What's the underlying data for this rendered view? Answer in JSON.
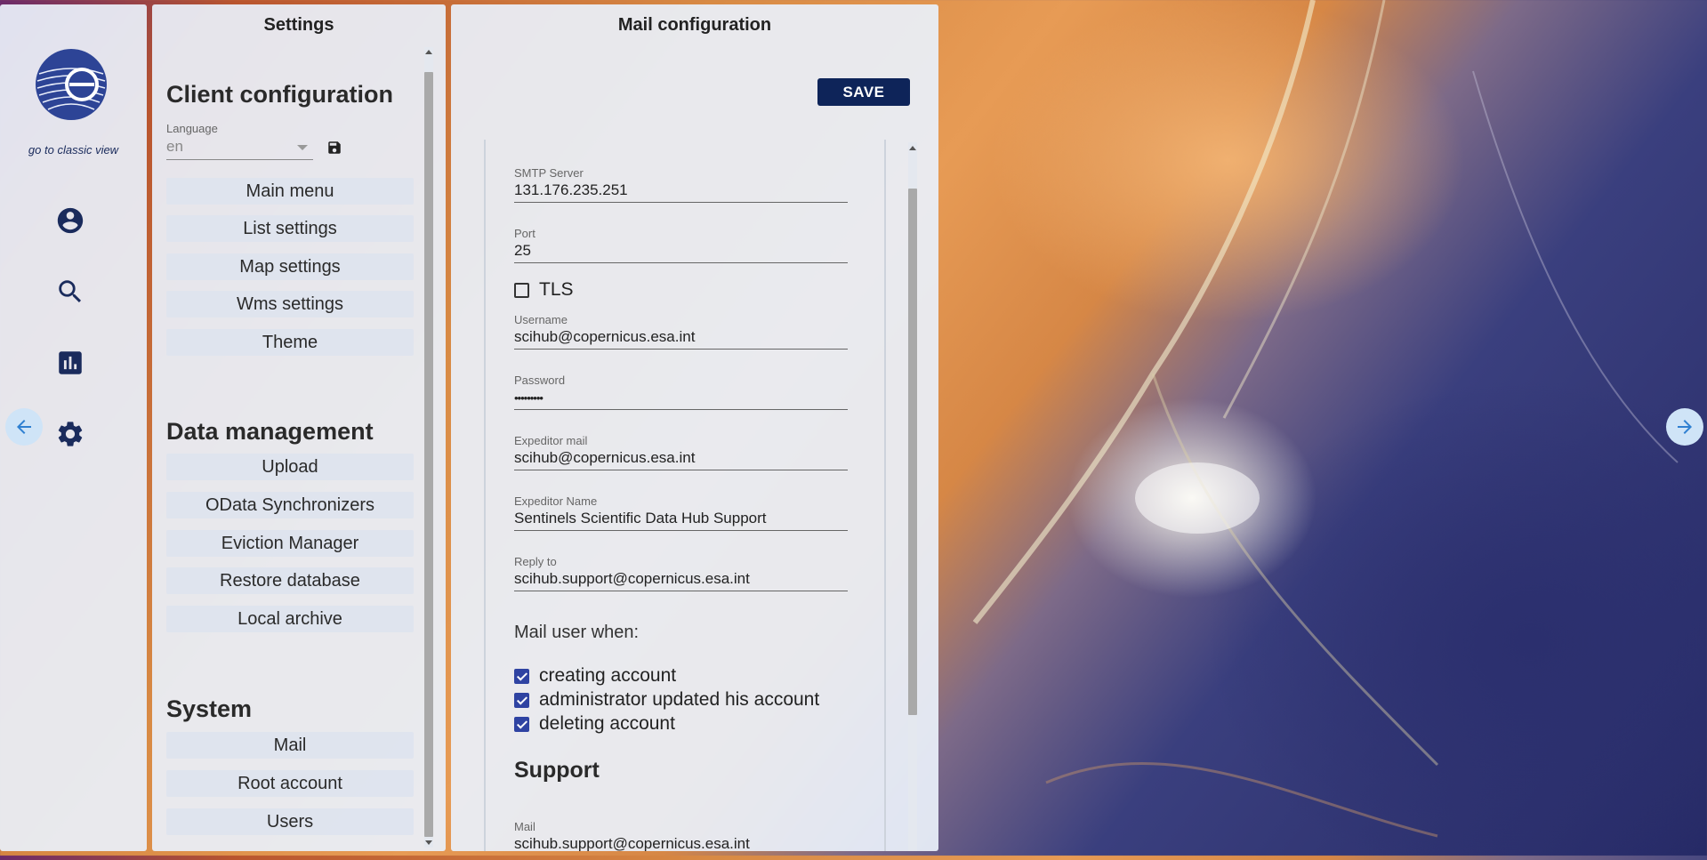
{
  "nav": {
    "classic_link": "go to classic view",
    "icons": [
      "account-circle-icon",
      "search-icon",
      "bar-chart-icon",
      "gear-icon"
    ]
  },
  "settings": {
    "title": "Settings",
    "client_config": {
      "heading": "Client configuration",
      "language_label": "Language",
      "language_value": "en",
      "items": [
        "Main menu",
        "List settings",
        "Map settings",
        "Wms settings",
        "Theme"
      ]
    },
    "data_management": {
      "heading": "Data management",
      "items": [
        "Upload",
        "OData Synchronizers",
        "Eviction Manager",
        "Restore database",
        "Local archive"
      ]
    },
    "system": {
      "heading": "System",
      "items": [
        "Mail",
        "Root account",
        "Users"
      ]
    }
  },
  "mail": {
    "title": "Mail configuration",
    "save_label": "SAVE",
    "smtp_server": {
      "label": "SMTP Server",
      "value": "131.176.235.251"
    },
    "port": {
      "label": "Port",
      "value": "25"
    },
    "tls": {
      "label": "TLS",
      "checked": false
    },
    "username": {
      "label": "Username",
      "value": "scihub@copernicus.esa.int"
    },
    "password": {
      "label": "Password",
      "value": "•••••••••"
    },
    "expeditor_mail": {
      "label": "Expeditor mail",
      "value": "scihub@copernicus.esa.int"
    },
    "expeditor_name": {
      "label": "Expeditor Name",
      "value": "Sentinels Scientific Data Hub Support"
    },
    "reply_to": {
      "label": "Reply to",
      "value": "scihub.support@copernicus.esa.int"
    },
    "mail_user_when": "Mail user when:",
    "options": [
      {
        "label": "creating account",
        "checked": true
      },
      {
        "label": "administrator updated his account",
        "checked": true
      },
      {
        "label": "deleting account",
        "checked": true
      }
    ],
    "support": {
      "heading": "Support",
      "mail_label": "Mail",
      "mail_value": "scihub.support@copernicus.esa.int"
    }
  },
  "colors": {
    "accent_dark": "#0e2459",
    "checkbox": "#2f43a2",
    "icon": "#1a2b5c",
    "circle_btn": "#cfe4f7"
  }
}
